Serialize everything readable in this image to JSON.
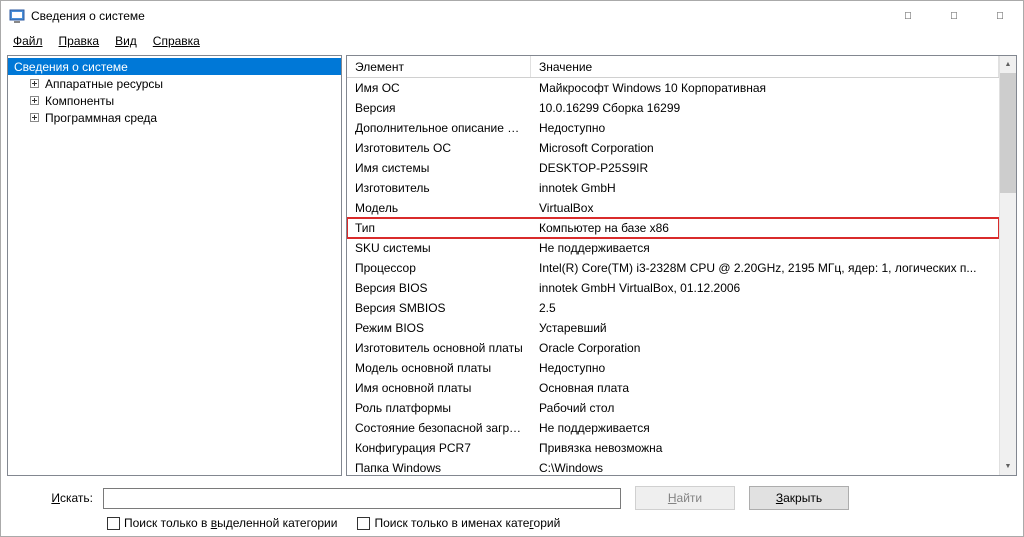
{
  "window": {
    "title": "Сведения о системе"
  },
  "menubar": [
    "Файл",
    "Правка",
    "Вид",
    "Справка"
  ],
  "tree": {
    "root": "Сведения о системе",
    "children": [
      "Аппаратные ресурсы",
      "Компоненты",
      "Программная среда"
    ]
  },
  "table": {
    "headers": [
      "Элемент",
      "Значение"
    ],
    "rows": [
      {
        "el": "Имя ОС",
        "val": "Майкрософт Windows 10 Корпоративная"
      },
      {
        "el": "Версия",
        "val": "10.0.16299 Сборка 16299"
      },
      {
        "el": "Дополнительное описание ОС",
        "val": "Недоступно"
      },
      {
        "el": "Изготовитель ОС",
        "val": "Microsoft Corporation"
      },
      {
        "el": "Имя системы",
        "val": "DESKTOP-P25S9IR"
      },
      {
        "el": "Изготовитель",
        "val": "innotek GmbH"
      },
      {
        "el": "Модель",
        "val": "VirtualBox"
      },
      {
        "el": "Тип",
        "val": "Компьютер на базе x86",
        "highlight": true
      },
      {
        "el": "SKU системы",
        "val": "Не поддерживается"
      },
      {
        "el": "Процессор",
        "val": "Intel(R) Core(TM) i3-2328M CPU @ 2.20GHz, 2195 МГц, ядер: 1, логических п..."
      },
      {
        "el": "Версия BIOS",
        "val": "innotek GmbH VirtualBox, 01.12.2006"
      },
      {
        "el": "Версия SMBIOS",
        "val": "2.5"
      },
      {
        "el": "Режим BIOS",
        "val": "Устаревший"
      },
      {
        "el": "Изготовитель основной платы",
        "val": "Oracle Corporation"
      },
      {
        "el": "Модель основной платы",
        "val": "Недоступно"
      },
      {
        "el": "Имя основной платы",
        "val": "Основная плата"
      },
      {
        "el": "Роль платформы",
        "val": "Рабочий стол"
      },
      {
        "el": "Состояние безопасной загруз...",
        "val": "Не поддерживается"
      },
      {
        "el": "Конфигурация PCR7",
        "val": "Привязка невозможна"
      },
      {
        "el": "Папка Windows",
        "val": "C:\\Windows"
      }
    ]
  },
  "search": {
    "label_pre": "И",
    "label_rest": "скать:",
    "find_pre": "Н",
    "find_rest": "айти",
    "close_pre": "З",
    "close_rest": "акрыть",
    "chk1_pre": "Поиск только в ",
    "chk1_ul": "в",
    "chk1_rest": "ыделенной категории",
    "chk2_pre": "Поиск только в именах кате",
    "chk2_ul": "г",
    "chk2_rest": "орий"
  }
}
